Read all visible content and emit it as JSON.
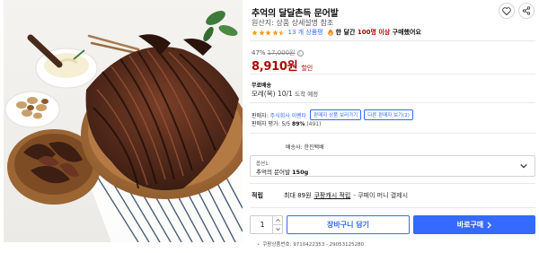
{
  "product": {
    "title": "추억의 달달촌득 문어발",
    "origin_label": "원산지:",
    "origin_value": "상품 상세설명 참조"
  },
  "rating": {
    "stars": 4.5,
    "review_count": "13 개 상품평",
    "buy_prefix": "한 달간",
    "buy_highlight": "100명 이상",
    "buy_suffix": "구매했어요"
  },
  "price": {
    "discount_rate": "47%",
    "original_price": "17,000원",
    "sale_price": "8,910원",
    "coupon_label": "할인"
  },
  "shipping": {
    "label": "무료배송",
    "arrival": "모레(목) 10/1",
    "arrival_note": "도착 예정",
    "company_label": "배송사:",
    "company": "한진택배"
  },
  "seller": {
    "label": "판매자:",
    "name": "주식회사 이벤타",
    "other_products_button": "판매자 상품 보러가기",
    "other_sellers_button": "다른 판매자 보기(2)",
    "rating_label": "판매자 평가:",
    "rating_stars": "5/5",
    "rating_pct": "89%",
    "rating_count": "(491)"
  },
  "option": {
    "label": "옵션1:",
    "value": "추억의 문어발",
    "weight": "150g"
  },
  "reward": {
    "title": "적립",
    "cash": "최대 89원",
    "link": "쿠팡캐시 적립",
    "pay": "- 쿠페이 머니 결제시"
  },
  "purchase": {
    "quantity": "1",
    "cart_button": "장바구니 담기",
    "buy_button": "바로구매"
  },
  "footer": {
    "product_number": "쿠팡상품번호: 9710422353 - 29053125280"
  },
  "colors": {
    "brand_blue": "#346aff",
    "price_red": "#ae0000",
    "star_orange": "#f49f19"
  }
}
